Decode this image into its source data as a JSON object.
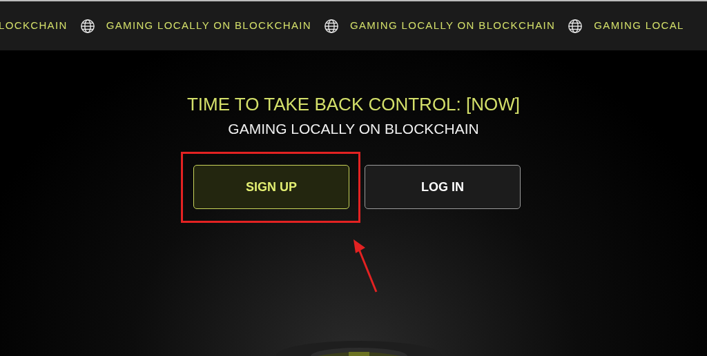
{
  "marquee": [
    "LOCKCHAIN",
    "GAMING LOCALLY ON BLOCKCHAIN",
    "GAMING LOCALLY ON BLOCKCHAIN",
    "GAMING LOCAL"
  ],
  "hero": {
    "title": "TIME TO TAKE BACK CONTROL: [NOW]",
    "subtitle": "GAMING LOCALLY ON BLOCKCHAIN"
  },
  "buttons": [
    {
      "label": "SIGN UP",
      "kind": "primary",
      "highlighted": true
    },
    {
      "label": "LOG IN",
      "kind": "secondary",
      "highlighted": false
    }
  ]
}
